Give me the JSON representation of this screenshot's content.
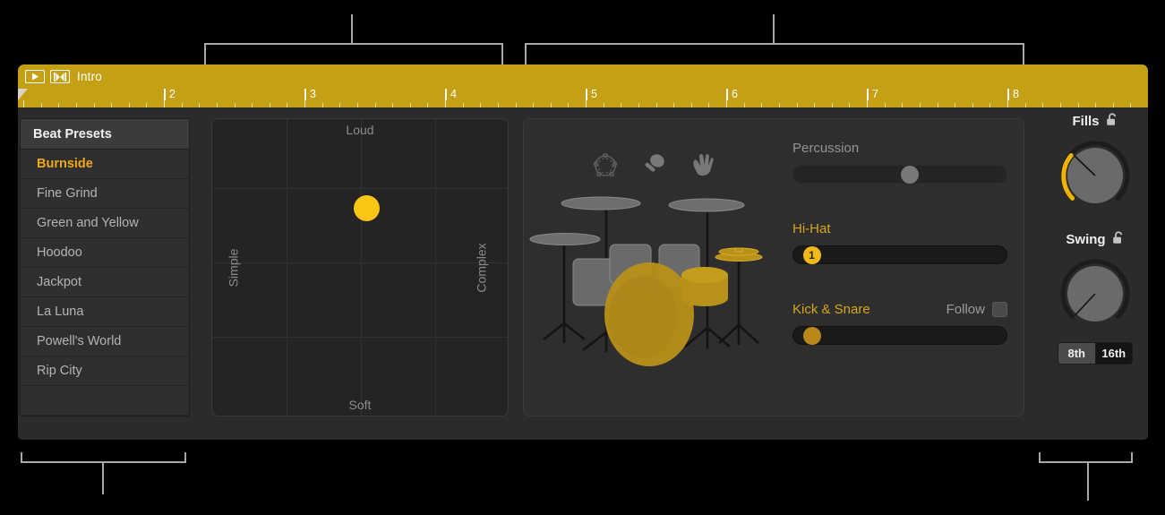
{
  "window": {
    "region_name": "Intro",
    "play_icon": "play-icon",
    "follow-tempo_icon": "follow-tempo-icon"
  },
  "ruler": {
    "bars": [
      "2",
      "3",
      "4",
      "5",
      "6",
      "7",
      "8"
    ],
    "playhead_position": "1"
  },
  "presets": {
    "title": "Beat Presets",
    "items": [
      {
        "label": "Burnside",
        "selected": true
      },
      {
        "label": "Fine Grind",
        "selected": false
      },
      {
        "label": "Green and Yellow",
        "selected": false
      },
      {
        "label": "Hoodoo",
        "selected": false
      },
      {
        "label": "Jackpot",
        "selected": false
      },
      {
        "label": "La Luna",
        "selected": false
      },
      {
        "label": "Powell's World",
        "selected": false
      },
      {
        "label": "Rip City",
        "selected": false
      }
    ]
  },
  "xy_pad": {
    "top_label": "Loud",
    "bottom_label": "Soft",
    "left_label": "Simple",
    "right_label": "Complex",
    "puck_x_percent": 52,
    "puck_y_percent": 30,
    "puck_color": "#fbc515"
  },
  "drum_panel": {
    "percussion_icons": [
      "tambourine-icon",
      "shaker-icon",
      "clap-icon"
    ],
    "controls": [
      {
        "label": "Percussion",
        "state": "dimmed",
        "knob_percent": 50,
        "knob_style": "grey",
        "knob_text": ""
      },
      {
        "label": "Hi-Hat",
        "state": "active",
        "knob_percent": 4,
        "knob_style": "gold",
        "knob_text": "1"
      },
      {
        "label": "Kick & Snare",
        "state": "active",
        "knob_percent": 4,
        "knob_style": "darkgold",
        "knob_text": "",
        "follow_label": "Follow",
        "follow_checked": false
      }
    ]
  },
  "rail": {
    "fills": {
      "title": "Fills",
      "lock_icon": "unlocked-padlock-icon",
      "value_percent": 14
    },
    "swing": {
      "title": "Swing",
      "lock_icon": "unlocked-padlock-icon",
      "value_percent": 0,
      "segments": [
        {
          "label": "8th",
          "active": false
        },
        {
          "label": "16th",
          "active": true
        }
      ]
    }
  },
  "colors": {
    "accent_gold": "#c5a014",
    "highlight_yellow": "#f0a91c",
    "puck_yellow": "#fbc515",
    "panel_bg": "#2b2b2b",
    "callout_grey": "#a9a9a9"
  }
}
